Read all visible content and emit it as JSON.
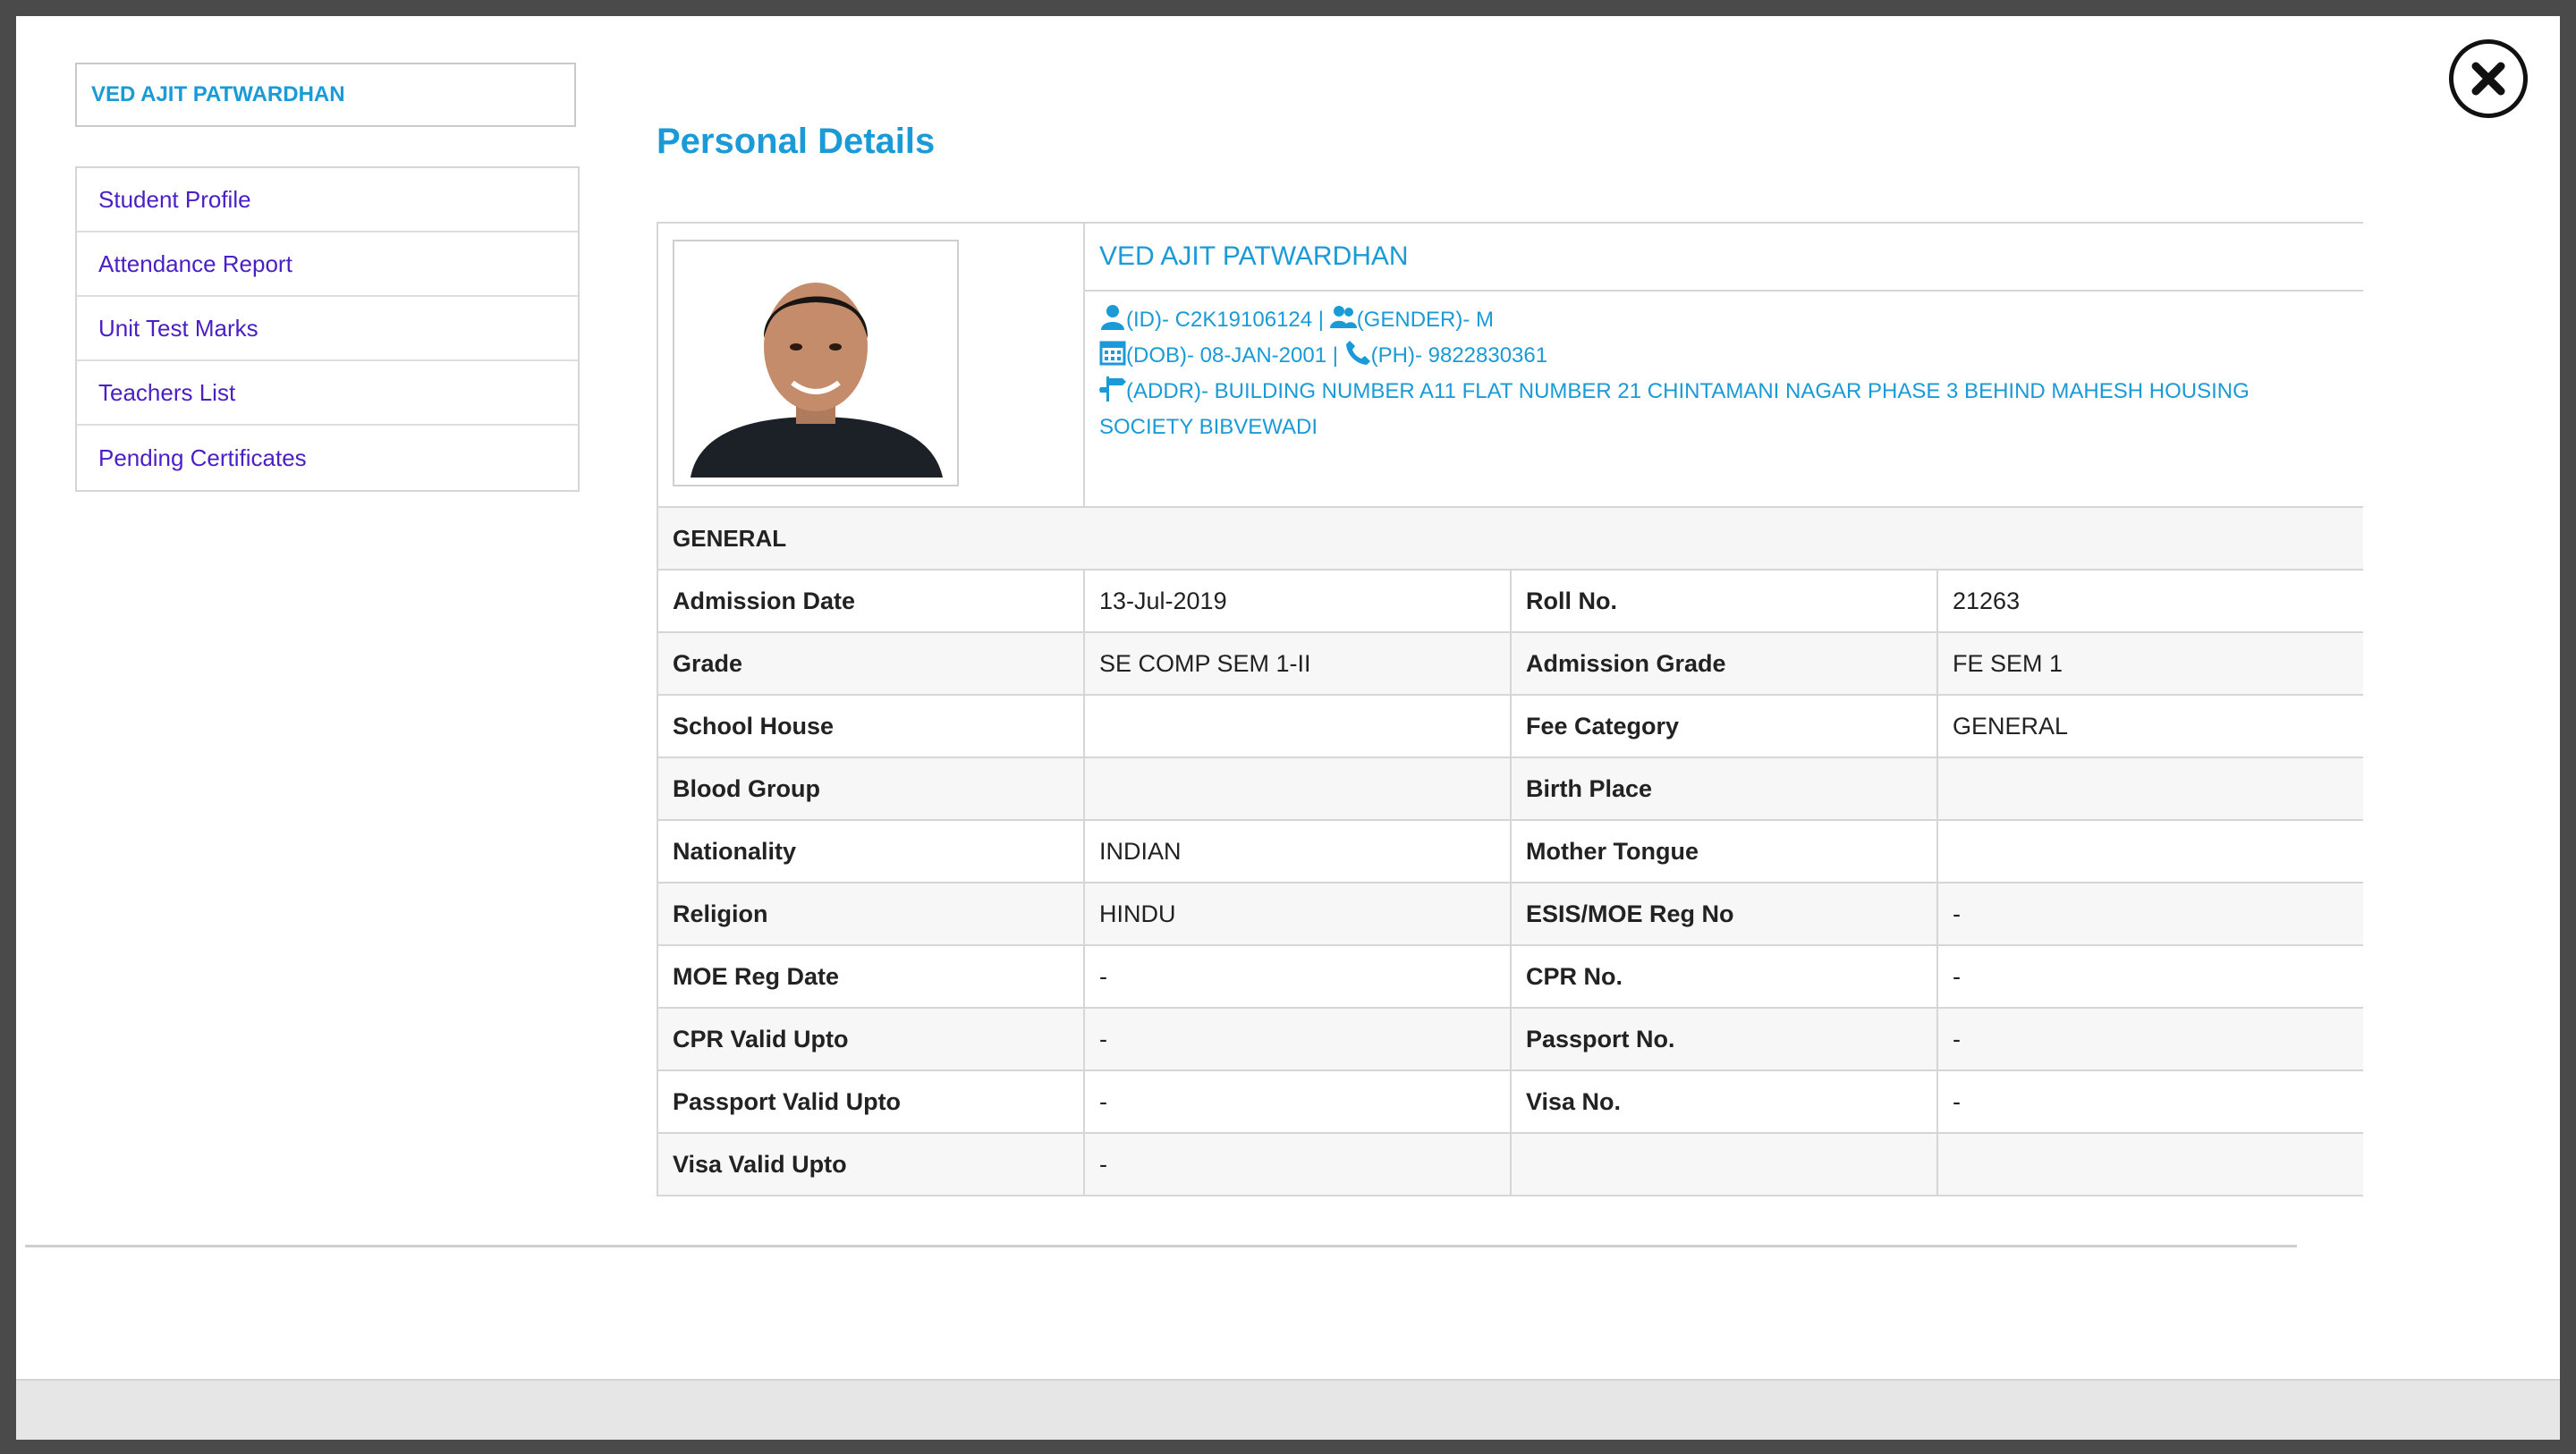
{
  "sidebar": {
    "student_name": "VED AJIT PATWARDHAN",
    "items": [
      {
        "label": "Student Profile"
      },
      {
        "label": "Attendance Report"
      },
      {
        "label": "Unit Test Marks"
      },
      {
        "label": "Teachers List"
      },
      {
        "label": "Pending Certificates"
      }
    ]
  },
  "main": {
    "title": "Personal Details",
    "profile": {
      "name": "VED AJIT PATWARDHAN",
      "id_line": "(ID)- C2K19106124 |",
      "gender_line": "(GENDER)- M",
      "dob_line": "(DOB)- 08-JAN-2001 |",
      "phone_line": "(PH)- 9822830361",
      "addr_line": "(ADDR)- BUILDING NUMBER A11 FLAT NUMBER 21 CHINTAMANI NAGAR PHASE 3 BEHIND MAHESH HOUSING SOCIETY BIBVEWADI"
    },
    "section_general": "GENERAL",
    "rows": [
      {
        "l1": "Admission Date",
        "v1": "13-Jul-2019",
        "l2": "Roll No.",
        "v2": "21263"
      },
      {
        "l1": "Grade",
        "v1": "SE COMP SEM 1-II",
        "l2": "Admission Grade",
        "v2": "FE SEM 1"
      },
      {
        "l1": "School House",
        "v1": "",
        "l2": "Fee Category",
        "v2": "GENERAL"
      },
      {
        "l1": "Blood Group",
        "v1": "",
        "l2": "Birth Place",
        "v2": ""
      },
      {
        "l1": "Nationality",
        "v1": "INDIAN",
        "l2": "Mother Tongue",
        "v2": ""
      },
      {
        "l1": "Religion",
        "v1": "HINDU",
        "l2": "ESIS/MOE Reg No",
        "v2": "-"
      },
      {
        "l1": "MOE Reg Date",
        "v1": "-",
        "l2": "CPR No.",
        "v2": "-"
      },
      {
        "l1": "CPR Valid Upto",
        "v1": "-",
        "l2": "Passport No.",
        "v2": "-"
      },
      {
        "l1": "Passport Valid Upto",
        "v1": "-",
        "l2": "Visa No.",
        "v2": "-"
      },
      {
        "l1": "Visa Valid Upto",
        "v1": "-",
        "l2": "",
        "v2": ""
      }
    ]
  },
  "colors": {
    "accent": "#1a9ad6",
    "menu_link": "#4a1fc5",
    "backdrop": "#4a4a4a"
  },
  "icons": [
    "close-icon",
    "user-icon",
    "users-icon",
    "calendar-icon",
    "phone-icon",
    "signpost-icon",
    "student-photo"
  ]
}
